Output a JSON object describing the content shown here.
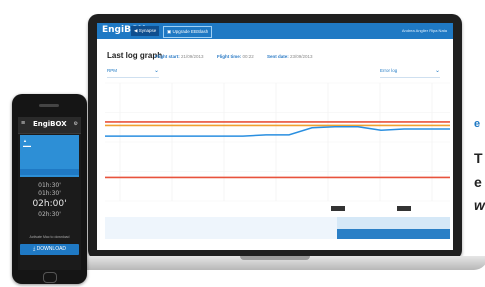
{
  "app": {
    "brand": "EngiBOX",
    "tabs": [
      {
        "label": "Synapse"
      },
      {
        "label": "Upgrade EBSlash"
      }
    ],
    "user": "Andrea Anglier Ripa Nata",
    "section_title": "Last log graph",
    "meta": [
      {
        "label": "Flight start:",
        "value": "21/09/2013"
      },
      {
        "label": "Flight time:",
        "value": "00:22"
      },
      {
        "label": "Sent date:",
        "value": "23/09/2013"
      }
    ],
    "left_select": "RPM",
    "right_select": "Error log"
  },
  "chart_data": {
    "type": "line",
    "series": [
      {
        "values": [
          0.45,
          0.45,
          0.45,
          0.45,
          0.45,
          0.45,
          0.45,
          0.44,
          0.44,
          0.38,
          0.37,
          0.37,
          0.4,
          0.39,
          0.39,
          0.39
        ]
      }
    ],
    "thresholds": [
      0.33,
      0.36,
      0.8
    ],
    "threshold_colors": [
      "#e8533c",
      "#f0a030",
      "#e8533c"
    ],
    "line_color": "#2a8fe0",
    "grid": true
  },
  "phone": {
    "brand": "EngiBOX",
    "times": [
      "01h:30'",
      "01h:30'",
      "02h:00'",
      "02h:30'"
    ],
    "footer_note": "Activate Mac to download",
    "download_label": "DOWNLOAD"
  },
  "side_text": [
    "e",
    "T",
    "e",
    "w"
  ]
}
